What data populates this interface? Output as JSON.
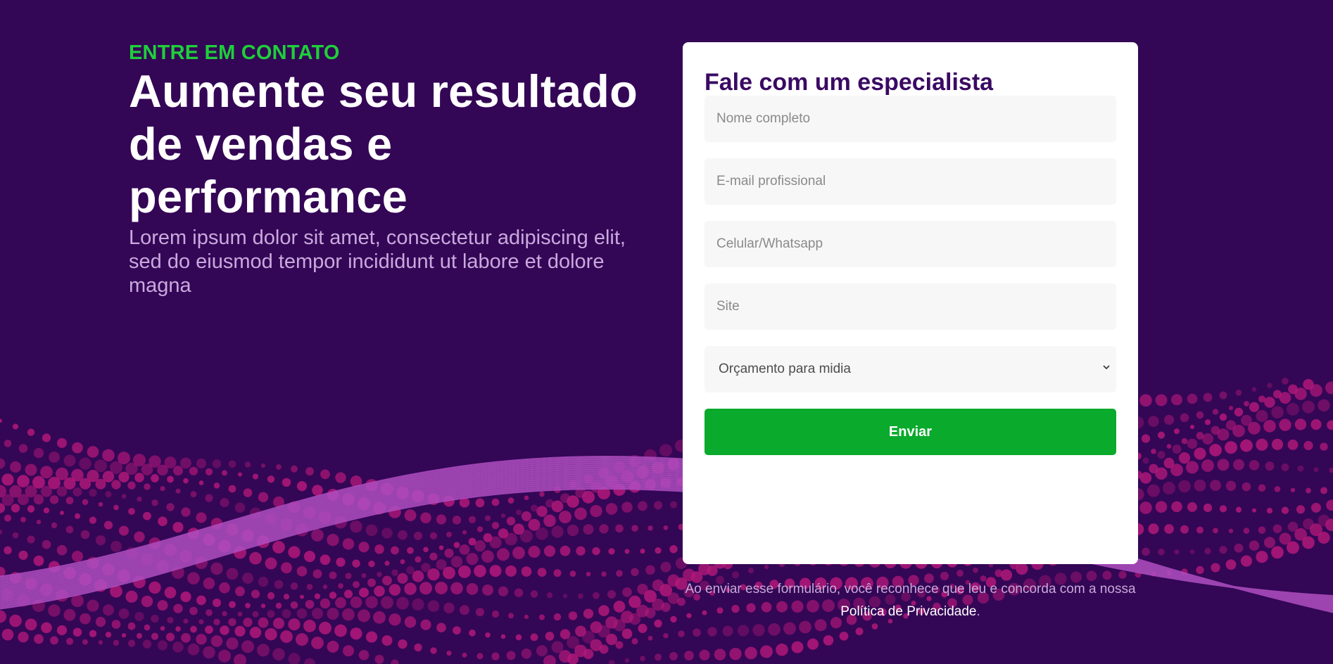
{
  "hero": {
    "eyebrow": "ENTRE EM CONTATO",
    "headline": "Aumente seu resultado de vendas e performance",
    "lead": "Lorem ipsum dolor sit amet, consectetur adipiscing elit, sed do eiusmod tempor incididunt ut labore et dolore magna"
  },
  "form": {
    "title": "Fale com um especialista",
    "fields": {
      "name": {
        "placeholder": "Nome completo",
        "value": ""
      },
      "email": {
        "placeholder": "E-mail profissional",
        "value": ""
      },
      "phone": {
        "placeholder": "Celular/Whatsapp",
        "value": ""
      },
      "site": {
        "placeholder": "Site",
        "value": ""
      }
    },
    "budget_select": {
      "selected": "Orçamento para midia",
      "icon": "chevron-down-icon"
    },
    "submit_label": "Enviar"
  },
  "disclaimer": {
    "text_before": "Ao enviar esse formulário, você reconhece que leu e concorda com a nossa ",
    "link_label": "Política de Privacidade",
    "text_after": "."
  },
  "colors": {
    "background": "#340656",
    "accent_green": "#1fcf3a",
    "button_green": "#0aaa2c",
    "title_purple": "#3a0a63",
    "wave_pink": "#b4197a",
    "wave_ribbon": "#b04fc2"
  }
}
